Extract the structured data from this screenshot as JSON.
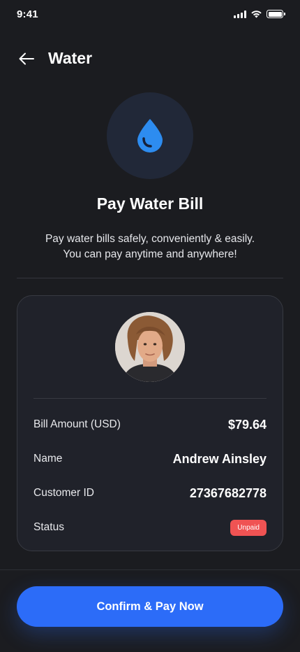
{
  "status_bar": {
    "time": "9:41"
  },
  "header": {
    "title": "Water",
    "back_icon": "arrow-left-icon"
  },
  "hero": {
    "icon": "water-drop-icon",
    "title": "Pay Water Bill",
    "description_line1": "Pay water bills safely, conveniently & easily.",
    "description_line2": "You can pay anytime and anywhere!"
  },
  "bill": {
    "rows": [
      {
        "label": "Bill Amount (USD)",
        "value": "$79.64"
      },
      {
        "label": "Name",
        "value": "Andrew Ainsley"
      },
      {
        "label": "Customer ID",
        "value": "27367682778"
      },
      {
        "label": "Status",
        "value": "Unpaid"
      }
    ]
  },
  "actions": {
    "pay_label": "Confirm & Pay Now"
  },
  "colors": {
    "background": "#1b1c20",
    "card": "#20222a",
    "accent": "#2c6cf8",
    "status_unpaid": "#f05353"
  }
}
